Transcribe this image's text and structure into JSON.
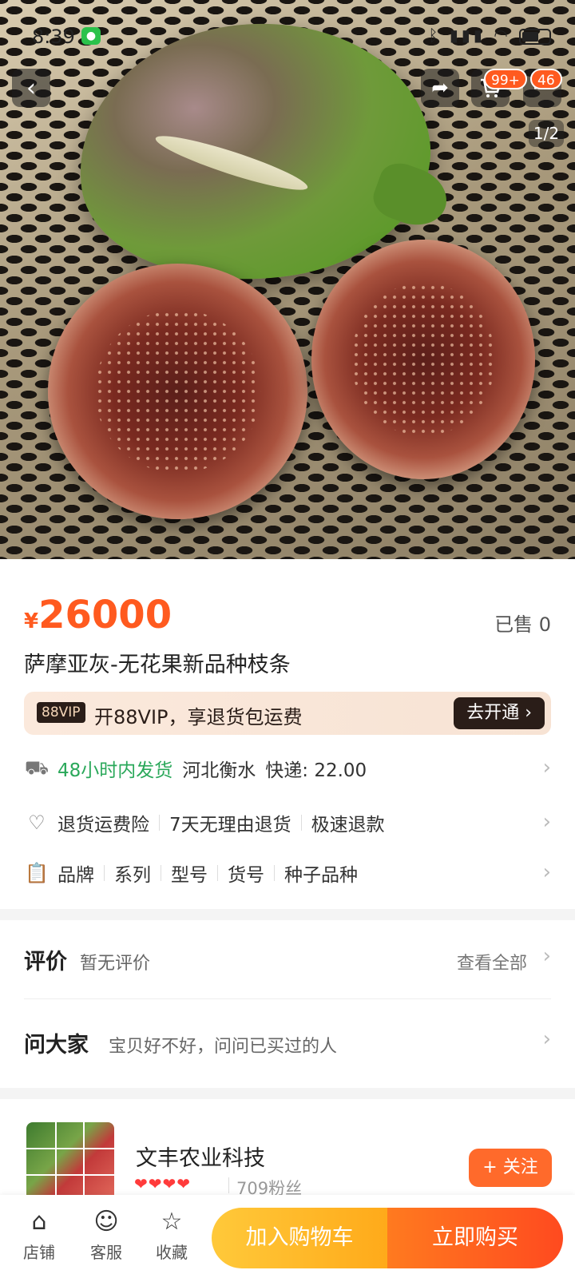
{
  "status_bar": {
    "time": "8:39",
    "battery_icon": "battery-icon"
  },
  "hero": {
    "pager": "1/2",
    "cart_badge": "99+",
    "message_badge": "46",
    "icons": {
      "back": "chevron-left-icon",
      "share": "share-icon",
      "cart": "cart-icon",
      "more": "more-icon"
    }
  },
  "product": {
    "currency": "¥",
    "price": "26000",
    "sold": "已售 0",
    "title": "萨摩亚灰-无花果新品种枝条"
  },
  "vip": {
    "tag": "88VIP",
    "text": "开88VIP，享退货包运费",
    "button": "去开通 ›"
  },
  "shipping": {
    "fast": "48小时内发货",
    "origin": "河北衡水",
    "fee": "快递: 22.00"
  },
  "guarantees": [
    "退货运费险",
    "7天无理由退货",
    "极速退款"
  ],
  "attributes": [
    "品牌",
    "系列",
    "型号",
    "货号",
    "种子品种"
  ],
  "reviews": {
    "title": "评价",
    "subtitle": "暂无评价",
    "view_all": "查看全部"
  },
  "ask": {
    "title": "问大家",
    "subtitle": "宝贝好不好，问问已买过的人"
  },
  "shop": {
    "name": "文丰农业科技",
    "hearts": "❤❤❤❤",
    "fans": "709粉丝",
    "follow": "+ 关注"
  },
  "bottom_bar": {
    "tabs": [
      {
        "label": "店铺",
        "icon": "store-icon"
      },
      {
        "label": "客服",
        "icon": "customer-service-icon"
      },
      {
        "label": "收藏",
        "icon": "star-icon"
      }
    ],
    "add_to_cart": "加入购物车",
    "buy_now": "立即购买"
  },
  "colors": {
    "accent": "#ff5a1f",
    "vip_dark": "#2a1d18",
    "green": "#2aa85a"
  }
}
